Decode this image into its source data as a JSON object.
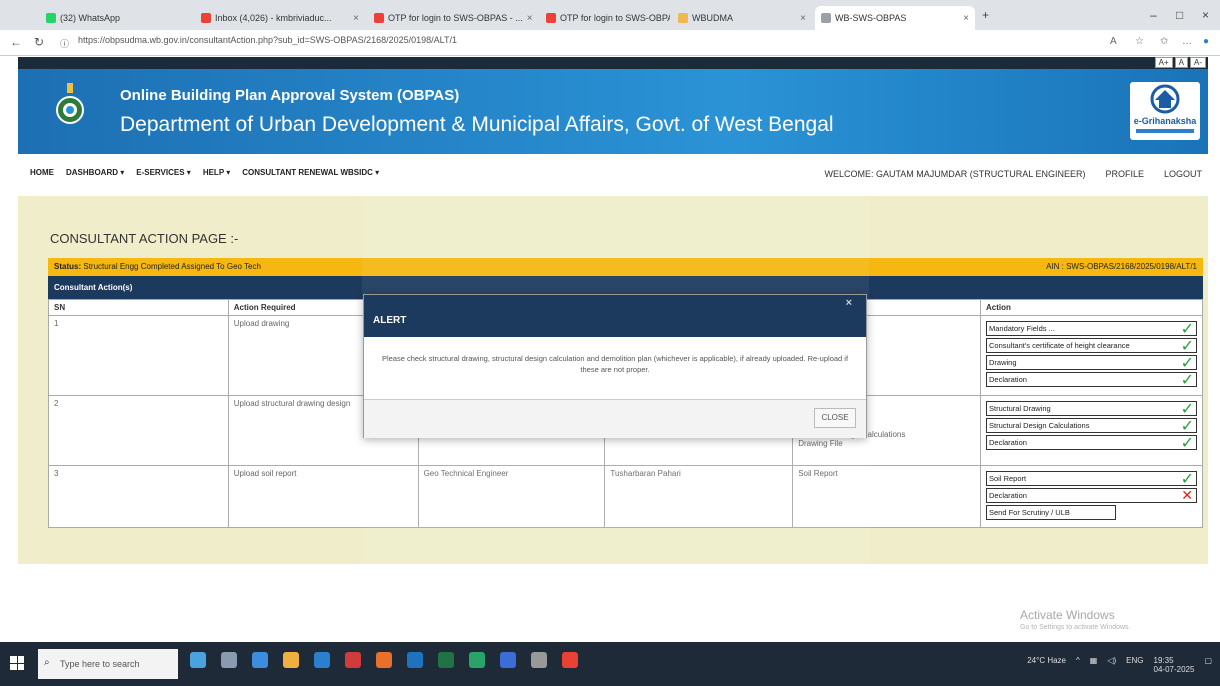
{
  "browser": {
    "tabs": [
      {
        "label": "(32) WhatsApp",
        "color": "#25d366"
      },
      {
        "label": "Inbox (4,026) - kmbriviaduc...",
        "color": "#ea4335"
      },
      {
        "label": "OTP for login to SWS-OBPAS - ...",
        "color": "#ea4335"
      },
      {
        "label": "OTP for login to SWS-OBPAS - ...",
        "color": "#ea4335"
      },
      {
        "label": "WBUDMA",
        "color": "#f2b84b"
      },
      {
        "label": "WB-SWS-OBPAS",
        "color": "#9aa0a6"
      }
    ],
    "url": "https://obpsudma.wb.gov.in/consultantAction.php?sub_id=SWS-OBPAS/2168/2025/0198/ALT/1"
  },
  "font_controls": [
    "A+",
    "A",
    "A-"
  ],
  "header": {
    "title": "Online Building Plan Approval System (OBPAS)",
    "subtitle": "Department of Urban Development & Municipal Affairs, Govt. of West Bengal",
    "right_logo_text": "e-Grihanaksha"
  },
  "menu": {
    "left": [
      "HOME",
      "DASHBOARD ▾",
      "E-SERVICES ▾",
      "HELP ▾",
      "CONSULTANT RENEWAL WBSIDC ▾"
    ],
    "welcome": "WELCOME: GAUTAM MAJUMDAR (STRUCTURAL ENGINEER)",
    "profile": "PROFILE",
    "logout": "LOGOUT"
  },
  "page": {
    "title": "CONSULTANT ACTION PAGE :-",
    "status_label": "Status:",
    "status_value": "Structural Engg Completed Assigned To Geo Tech",
    "ain": "AIN : SWS-OBPAS/2168/2025/0198/ALT/1",
    "table_caption": "Consultant Action(s)",
    "columns": [
      "SN",
      "Action Required",
      "",
      "",
      "",
      "Action"
    ],
    "rows": [
      {
        "sn": "1",
        "action_required": "Upload drawing",
        "col3": "",
        "col4": "",
        "col5": "",
        "actions": [
          {
            "label": "Mandatory Fields ...",
            "state": "ok"
          },
          {
            "label": "Consultant's certificate of height clearance",
            "state": "ok"
          },
          {
            "label": "Drawing",
            "state": "ok"
          },
          {
            "label": "Declaration",
            "state": "ok"
          }
        ]
      },
      {
        "sn": "2",
        "action_required": "Upload structural drawing design",
        "col3": "",
        "col4": "",
        "col5": "Structural Drawing\nStructural Design Calculations\nDrawing File",
        "actions": [
          {
            "label": "Structural Drawing",
            "state": "ok"
          },
          {
            "label": "Structural Design Calculations",
            "state": "ok"
          },
          {
            "label": "Declaration",
            "state": "ok"
          }
        ]
      },
      {
        "sn": "3",
        "action_required": "Upload soil report",
        "col3": "Geo Technical Engineer",
        "col4": "Tusharbaran Pahari",
        "col5": "Soil Report",
        "actions": [
          {
            "label": "Soil Report",
            "state": "ok"
          },
          {
            "label": "Declaration",
            "state": "fail"
          },
          {
            "label": "Send For Scrutiny / ULB",
            "state": "none"
          }
        ]
      }
    ]
  },
  "modal": {
    "title": "ALERT",
    "close_x": "×",
    "body": "Please check structural drawing, structural design calculation and demolition plan (whichever is applicable), if already uploaded. Re-upload if these are not proper.",
    "close_button": "CLOSE"
  },
  "watermark": {
    "line1": "Activate Windows",
    "line2": "Go to Settings to activate Windows."
  },
  "taskbar": {
    "search_placeholder": "Type here to search",
    "weather": "24°C Haze",
    "lang": "ENG",
    "time": "19:35",
    "date": "04-07-2025"
  }
}
